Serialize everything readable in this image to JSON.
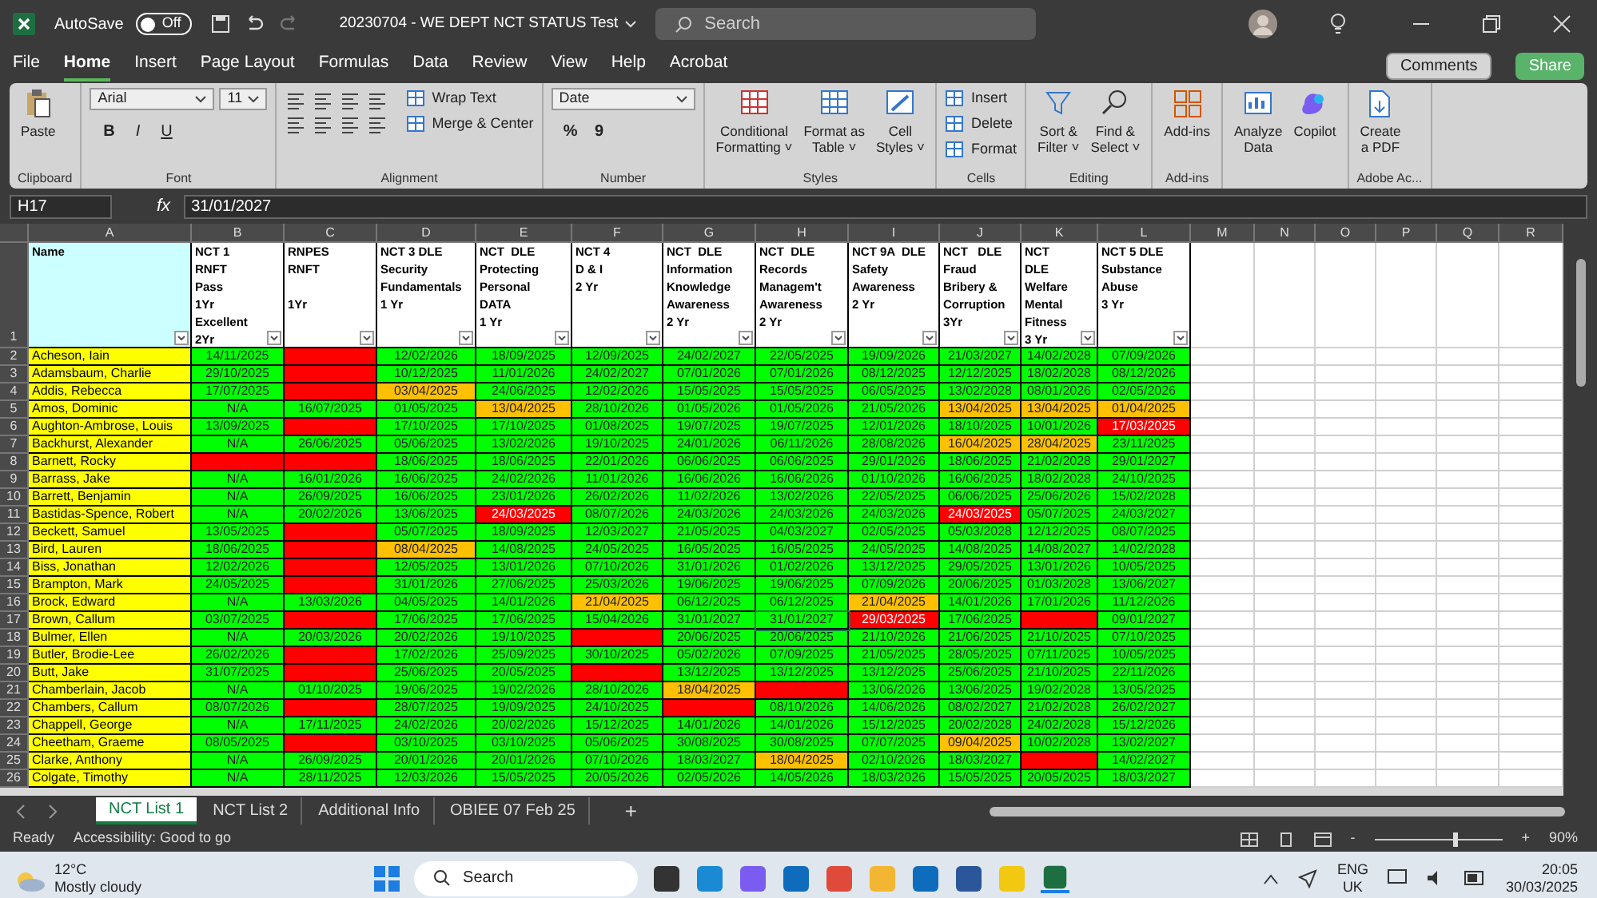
{
  "title_bar": {
    "autosave_label": "AutoSave",
    "autosave_state": "Off",
    "autosave_on": false,
    "file_name": "20230704 - WE DEPT NCT STATUS Test",
    "search_placeholder": "Search"
  },
  "menu": [
    {
      "label": "File",
      "selected": false
    },
    {
      "label": "Home",
      "selected": true
    },
    {
      "label": "Insert",
      "selected": false
    },
    {
      "label": "Page Layout",
      "selected": false
    },
    {
      "label": "Formulas",
      "selected": false
    },
    {
      "label": "Data",
      "selected": false
    },
    {
      "label": "Review",
      "selected": false
    },
    {
      "label": "View",
      "selected": false
    },
    {
      "label": "Help",
      "selected": false
    },
    {
      "label": "Acrobat",
      "selected": false
    }
  ],
  "comments_button": "Comments",
  "share_button": "Share",
  "ribbon": [
    {
      "label": "Clipboard",
      "buttons": [
        {
          "kind": "large",
          "label": "Paste"
        }
      ]
    },
    {
      "label": "Font",
      "buttons": [
        {
          "kind": "field",
          "label": "Arial"
        },
        {
          "kind": "field",
          "label": "11"
        },
        {
          "kind": "glyph",
          "label": "B"
        },
        {
          "kind": "glyph",
          "label": "I"
        },
        {
          "kind": "glyph",
          "label": "U"
        }
      ]
    },
    {
      "label": "Alignment",
      "buttons": [
        {
          "kind": "small",
          "label": "Wrap Text"
        },
        {
          "kind": "small",
          "label": "Merge & Center"
        }
      ]
    },
    {
      "label": "Number",
      "buttons": [
        {
          "kind": "field",
          "label": "Date"
        },
        {
          "kind": "glyph",
          "label": "%"
        },
        {
          "kind": "glyph",
          "label": "9"
        }
      ]
    },
    {
      "label": "Styles",
      "buttons": [
        {
          "kind": "large",
          "label": "Conditional\nFormatting ˅"
        },
        {
          "kind": "large",
          "label": "Format as\nTable ˅"
        },
        {
          "kind": "large",
          "label": "Cell\nStyles ˅"
        }
      ]
    },
    {
      "label": "Cells",
      "buttons": [
        {
          "kind": "small",
          "label": "Insert"
        },
        {
          "kind": "small",
          "label": "Delete"
        },
        {
          "kind": "small",
          "label": "Format"
        }
      ]
    },
    {
      "label": "Editing",
      "buttons": [
        {
          "kind": "large",
          "label": "Sort &\nFilter ˅"
        },
        {
          "kind": "large",
          "label": "Find &\nSelect ˅"
        }
      ]
    },
    {
      "label": "Add-ins",
      "buttons": [
        {
          "kind": "large",
          "label": "Add-ins"
        }
      ]
    },
    {
      "buttons": [
        {
          "kind": "large",
          "label": "Analyze\nData"
        },
        {
          "kind": "large",
          "label": "Copilot"
        }
      ]
    },
    {
      "label": "Adobe Ac...",
      "buttons": [
        {
          "kind": "large",
          "label": "Create\na PDF"
        }
      ]
    }
  ],
  "formula_bar": {
    "name_box": "H17",
    "fx": "fx",
    "formula": "31/01/2027"
  },
  "header_row_number": "1",
  "column_letters": [
    "A",
    "B",
    "C",
    "D",
    "E",
    "F",
    "G",
    "H",
    "I",
    "J",
    "K",
    "L",
    "M",
    "N",
    "O",
    "P",
    "Q",
    "R"
  ],
  "headers": [
    "Name",
    "NCT 1\nRNFT\nPass\n1Yr\nExcellent\n2Yr",
    "RNPES\nRNFT\n\n1Yr",
    "NCT 3 DLE\nSecurity\nFundamentals\n1 Yr",
    "NCT  DLE\nProtecting\nPersonal\nDATA\n1 Yr",
    "NCT 4\nD & I\n2 Yr",
    "NCT  DLE\nInformation\nKnowledge\nAwareness\n2 Yr",
    "NCT  DLE\nRecords\nManagem't\nAwareness\n2 Yr",
    "NCT 9A  DLE\nSafety\nAwareness\n2 Yr",
    "NCT   DLE\nFraud\nBribery &\nCorruption\n3Yr",
    "NCT\nDLE\nWelfare\nMental\nFitness\n3 Yr",
    "NCT 5 DLE\nSubstance\nAbuse\n3 Yr"
  ],
  "rows": [
    {
      "number": "2",
      "name": "Acheson, Iain",
      "cells": [
        {
          "text": "14/11/2025",
          "color": "#00ff00"
        },
        {
          "color": "#ff0000"
        },
        {
          "text": "12/02/2026",
          "color": "#00ff00"
        },
        {
          "text": "18/09/2025",
          "color": "#00ff00"
        },
        {
          "text": "12/09/2025",
          "color": "#00ff00"
        },
        {
          "text": "24/02/2027",
          "color": "#00ff00"
        },
        {
          "text": "22/05/2025",
          "color": "#00ff00"
        },
        {
          "text": "19/09/2026",
          "color": "#00ff00"
        },
        {
          "text": "21/03/2027",
          "color": "#00ff00"
        },
        {
          "text": "14/02/2028",
          "color": "#00ff00"
        },
        {
          "text": "07/09/2026",
          "color": "#00ff00"
        }
      ]
    },
    {
      "number": "3",
      "name": "Adamsbaum, Charlie",
      "cells": [
        {
          "text": "29/10/2025",
          "color": "#00ff00"
        },
        {
          "color": "#ff0000"
        },
        {
          "text": "10/12/2025",
          "color": "#00ff00"
        },
        {
          "text": "11/01/2026",
          "color": "#00ff00"
        },
        {
          "text": "24/02/2027",
          "color": "#00ff00"
        },
        {
          "text": "07/01/2026",
          "color": "#00ff00"
        },
        {
          "text": "07/01/2026",
          "color": "#00ff00"
        },
        {
          "text": "08/12/2025",
          "color": "#00ff00"
        },
        {
          "text": "12/12/2025",
          "color": "#00ff00"
        },
        {
          "text": "18/02/2028",
          "color": "#00ff00"
        },
        {
          "text": "08/12/2026",
          "color": "#00ff00"
        }
      ]
    },
    {
      "number": "4",
      "name": "Addis, Rebecca",
      "cells": [
        {
          "text": "17/07/2025",
          "color": "#00ff00"
        },
        {
          "color": "#ff0000"
        },
        {
          "text": "03/04/2025",
          "color": "#ffc000"
        },
        {
          "text": "24/06/2025",
          "color": "#00ff00"
        },
        {
          "text": "12/02/2026",
          "color": "#00ff00"
        },
        {
          "text": "15/05/2025",
          "color": "#00ff00"
        },
        {
          "text": "15/05/2025",
          "color": "#00ff00"
        },
        {
          "text": "06/05/2025",
          "color": "#00ff00"
        },
        {
          "text": "13/02/2028",
          "color": "#00ff00"
        },
        {
          "text": "08/01/2026",
          "color": "#00ff00"
        },
        {
          "text": "02/05/2026",
          "color": "#00ff00"
        }
      ]
    },
    {
      "number": "5",
      "name": "Amos, Dominic",
      "cells": [
        {
          "text": "N/A",
          "color": "#00ff00"
        },
        {
          "text": "16/07/2025",
          "color": "#00ff00"
        },
        {
          "text": "01/05/2025",
          "color": "#00ff00"
        },
        {
          "text": "13/04/2025",
          "color": "#ffc000"
        },
        {
          "text": "28/10/2026",
          "color": "#00ff00"
        },
        {
          "text": "01/05/2026",
          "color": "#00ff00"
        },
        {
          "text": "01/05/2026",
          "color": "#00ff00"
        },
        {
          "text": "21/05/2026",
          "color": "#00ff00"
        },
        {
          "text": "13/04/2025",
          "color": "#ffc000"
        },
        {
          "text": "13/04/2025",
          "color": "#ffc000"
        },
        {
          "text": "01/04/2025",
          "color": "#ffc000"
        }
      ]
    },
    {
      "number": "6",
      "name": "Aughton-Ambrose, Louis",
      "cells": [
        {
          "text": "13/09/2025",
          "color": "#00ff00"
        },
        {
          "color": "#ff0000"
        },
        {
          "text": "17/10/2025",
          "color": "#00ff00"
        },
        {
          "text": "17/10/2025",
          "color": "#00ff00"
        },
        {
          "text": "01/08/2025",
          "color": "#00ff00"
        },
        {
          "text": "19/07/2025",
          "color": "#00ff00"
        },
        {
          "text": "19/07/2025",
          "color": "#00ff00"
        },
        {
          "text": "12/01/2026",
          "color": "#00ff00"
        },
        {
          "text": "18/10/2025",
          "color": "#00ff00"
        },
        {
          "text": "10/01/2026",
          "color": "#00ff00"
        },
        {
          "text": "17/03/2025",
          "color": "#ff0000"
        }
      ]
    },
    {
      "number": "7",
      "name": "Backhurst, Alexander",
      "cells": [
        {
          "text": "N/A",
          "color": "#00ff00"
        },
        {
          "text": "26/06/2025",
          "color": "#00ff00"
        },
        {
          "text": "05/06/2025",
          "color": "#00ff00"
        },
        {
          "text": "13/02/2026",
          "color": "#00ff00"
        },
        {
          "text": "19/10/2025",
          "color": "#00ff00"
        },
        {
          "text": "24/01/2026",
          "color": "#00ff00"
        },
        {
          "text": "06/11/2026",
          "color": "#00ff00"
        },
        {
          "text": "28/08/2026",
          "color": "#00ff00"
        },
        {
          "text": "16/04/2025",
          "color": "#ffc000"
        },
        {
          "text": "28/04/2025",
          "color": "#ffc000"
        },
        {
          "text": "23/11/2025",
          "color": "#00ff00"
        }
      ]
    },
    {
      "number": "8",
      "name": "Barnett, Rocky",
      "cells": [
        {
          "color": "#ff0000"
        },
        {
          "color": "#ff0000"
        },
        {
          "text": "18/06/2025",
          "color": "#00ff00"
        },
        {
          "text": "18/06/2025",
          "color": "#00ff00"
        },
        {
          "text": "22/01/2026",
          "color": "#00ff00"
        },
        {
          "text": "06/06/2025",
          "color": "#00ff00"
        },
        {
          "text": "06/06/2025",
          "color": "#00ff00"
        },
        {
          "text": "29/01/2026",
          "color": "#00ff00"
        },
        {
          "text": "18/06/2025",
          "color": "#00ff00"
        },
        {
          "text": "21/02/2028",
          "color": "#00ff00"
        },
        {
          "text": "29/01/2027",
          "color": "#00ff00"
        }
      ]
    },
    {
      "number": "9",
      "name": "Barrass, Jake",
      "cells": [
        {
          "text": "N/A",
          "color": "#00ff00"
        },
        {
          "text": "16/01/2026",
          "color": "#00ff00"
        },
        {
          "text": "16/06/2025",
          "color": "#00ff00"
        },
        {
          "text": "24/02/2026",
          "color": "#00ff00"
        },
        {
          "text": "11/01/2026",
          "color": "#00ff00"
        },
        {
          "text": "16/06/2026",
          "color": "#00ff00"
        },
        {
          "text": "16/06/2026",
          "color": "#00ff00"
        },
        {
          "text": "01/10/2026",
          "color": "#00ff00"
        },
        {
          "text": "16/06/2025",
          "color": "#00ff00"
        },
        {
          "text": "18/02/2028",
          "color": "#00ff00"
        },
        {
          "text": "24/10/2025",
          "color": "#00ff00"
        }
      ]
    },
    {
      "number": "10",
      "name": "Barrett, Benjamin",
      "cells": [
        {
          "text": "N/A",
          "color": "#00ff00"
        },
        {
          "text": "26/09/2025",
          "color": "#00ff00"
        },
        {
          "text": "16/06/2025",
          "color": "#00ff00"
        },
        {
          "text": "23/01/2026",
          "color": "#00ff00"
        },
        {
          "text": "26/02/2026",
          "color": "#00ff00"
        },
        {
          "text": "11/02/2026",
          "color": "#00ff00"
        },
        {
          "text": "13/02/2026",
          "color": "#00ff00"
        },
        {
          "text": "22/05/2025",
          "color": "#00ff00"
        },
        {
          "text": "06/06/2025",
          "color": "#00ff00"
        },
        {
          "text": "25/06/2026",
          "color": "#00ff00"
        },
        {
          "text": "15/02/2028",
          "color": "#00ff00"
        }
      ]
    },
    {
      "number": "11",
      "name": "Bastidas-Spence, Robert",
      "cells": [
        {
          "text": "N/A",
          "color": "#00ff00"
        },
        {
          "text": "20/02/2026",
          "color": "#00ff00"
        },
        {
          "text": "13/06/2025",
          "color": "#00ff00"
        },
        {
          "text": "24/03/2025",
          "color": "#ff0000"
        },
        {
          "text": "08/07/2026",
          "color": "#00ff00"
        },
        {
          "text": "24/03/2026",
          "color": "#00ff00"
        },
        {
          "text": "24/03/2026",
          "color": "#00ff00"
        },
        {
          "text": "24/03/2026",
          "color": "#00ff00"
        },
        {
          "text": "24/03/2025",
          "color": "#ff0000"
        },
        {
          "text": "05/07/2025",
          "color": "#00ff00"
        },
        {
          "text": "24/03/2027",
          "color": "#00ff00"
        }
      ]
    },
    {
      "number": "12",
      "name": "Beckett, Samuel",
      "cells": [
        {
          "text": "13/05/2025",
          "color": "#00ff00"
        },
        {
          "color": "#ff0000"
        },
        {
          "text": "05/07/2025",
          "color": "#00ff00"
        },
        {
          "text": "18/09/2025",
          "color": "#00ff00"
        },
        {
          "text": "12/03/2027",
          "color": "#00ff00"
        },
        {
          "text": "21/05/2025",
          "color": "#00ff00"
        },
        {
          "text": "04/03/2027",
          "color": "#00ff00"
        },
        {
          "text": "02/05/2025",
          "color": "#00ff00"
        },
        {
          "text": "05/03/2028",
          "color": "#00ff00"
        },
        {
          "text": "12/12/2025",
          "color": "#00ff00"
        },
        {
          "text": "08/07/2025",
          "color": "#00ff00"
        }
      ]
    },
    {
      "number": "13",
      "name": "Bird, Lauren",
      "cells": [
        {
          "text": "18/06/2025",
          "color": "#00ff00"
        },
        {
          "color": "#ff0000"
        },
        {
          "text": "08/04/2025",
          "color": "#ffc000"
        },
        {
          "text": "14/08/2025",
          "color": "#00ff00"
        },
        {
          "text": "24/05/2025",
          "color": "#00ff00"
        },
        {
          "text": "16/05/2025",
          "color": "#00ff00"
        },
        {
          "text": "16/05/2025",
          "color": "#00ff00"
        },
        {
          "text": "24/05/2025",
          "color": "#00ff00"
        },
        {
          "text": "14/08/2025",
          "color": "#00ff00"
        },
        {
          "text": "14/08/2027",
          "color": "#00ff00"
        },
        {
          "text": "14/02/2028",
          "color": "#00ff00"
        }
      ]
    },
    {
      "number": "14",
      "name": "Biss, Jonathan",
      "cells": [
        {
          "text": "12/02/2026",
          "color": "#00ff00"
        },
        {
          "color": "#ff0000"
        },
        {
          "text": "12/05/2025",
          "color": "#00ff00"
        },
        {
          "text": "13/01/2026",
          "color": "#00ff00"
        },
        {
          "text": "07/10/2026",
          "color": "#00ff00"
        },
        {
          "text": "31/01/2026",
          "color": "#00ff00"
        },
        {
          "text": "01/02/2026",
          "color": "#00ff00"
        },
        {
          "text": "13/12/2025",
          "color": "#00ff00"
        },
        {
          "text": "29/05/2025",
          "color": "#00ff00"
        },
        {
          "text": "13/01/2026",
          "color": "#00ff00"
        },
        {
          "text": "10/05/2025",
          "color": "#00ff00"
        }
      ]
    },
    {
      "number": "15",
      "name": "Brampton, Mark",
      "cells": [
        {
          "text": "24/05/2025",
          "color": "#00ff00"
        },
        {
          "color": "#ff0000"
        },
        {
          "text": "31/01/2026",
          "color": "#00ff00"
        },
        {
          "text": "27/06/2025",
          "color": "#00ff00"
        },
        {
          "text": "25/03/2026",
          "color": "#00ff00"
        },
        {
          "text": "19/06/2025",
          "color": "#00ff00"
        },
        {
          "text": "19/06/2025",
          "color": "#00ff00"
        },
        {
          "text": "07/09/2026",
          "color": "#00ff00"
        },
        {
          "text": "20/06/2025",
          "color": "#00ff00"
        },
        {
          "text": "01/03/2028",
          "color": "#00ff00"
        },
        {
          "text": "13/06/2027",
          "color": "#00ff00"
        }
      ]
    },
    {
      "number": "16",
      "name": "Brock, Edward",
      "cells": [
        {
          "text": "N/A",
          "color": "#00ff00"
        },
        {
          "text": "13/03/2026",
          "color": "#00ff00"
        },
        {
          "text": "04/05/2025",
          "color": "#00ff00"
        },
        {
          "text": "14/01/2026",
          "color": "#00ff00"
        },
        {
          "text": "21/04/2025",
          "color": "#ffc000"
        },
        {
          "text": "06/12/2025",
          "color": "#00ff00"
        },
        {
          "text": "06/12/2025",
          "color": "#00ff00"
        },
        {
          "text": "21/04/2025",
          "color": "#ffc000"
        },
        {
          "text": "14/01/2026",
          "color": "#00ff00"
        },
        {
          "text": "17/01/2026",
          "color": "#00ff00"
        },
        {
          "text": "11/12/2026",
          "color": "#00ff00"
        }
      ]
    },
    {
      "number": "17",
      "name": "Brown, Callum",
      "cells": [
        {
          "text": "03/07/2025",
          "color": "#00ff00"
        },
        {
          "color": "#ff0000"
        },
        {
          "text": "17/06/2025",
          "color": "#00ff00"
        },
        {
          "text": "17/06/2025",
          "color": "#00ff00"
        },
        {
          "text": "15/04/2026",
          "color": "#00ff00"
        },
        {
          "text": "31/01/2027",
          "color": "#00ff00"
        },
        {
          "text": "31/01/2027",
          "color": "#00ff00",
          "selected": true
        },
        {
          "text": "29/03/2025",
          "color": "#ff0000"
        },
        {
          "text": "17/06/2025",
          "color": "#00ff00"
        },
        {
          "color": "#ff0000"
        },
        {
          "text": "09/01/2027",
          "color": "#00ff00"
        }
      ]
    },
    {
      "number": "18",
      "name": "Bulmer, Ellen",
      "cells": [
        {
          "text": "N/A",
          "color": "#00ff00"
        },
        {
          "text": "20/03/2026",
          "color": "#00ff00"
        },
        {
          "text": "20/02/2026",
          "color": "#00ff00"
        },
        {
          "text": "19/10/2025",
          "color": "#00ff00"
        },
        {
          "color": "#ff0000"
        },
        {
          "text": "20/06/2025",
          "color": "#00ff00"
        },
        {
          "text": "20/06/2025",
          "color": "#00ff00"
        },
        {
          "text": "21/10/2026",
          "color": "#00ff00"
        },
        {
          "text": "21/06/2025",
          "color": "#00ff00"
        },
        {
          "text": "21/10/2025",
          "color": "#00ff00"
        },
        {
          "text": "07/10/2025",
          "color": "#00ff00"
        }
      ]
    },
    {
      "number": "19",
      "name": "Butler, Brodie-Lee",
      "cells": [
        {
          "text": "26/02/2026",
          "color": "#00ff00"
        },
        {
          "color": "#ff0000"
        },
        {
          "text": "17/02/2026",
          "color": "#00ff00"
        },
        {
          "text": "25/09/2025",
          "color": "#00ff00"
        },
        {
          "text": "30/10/2025",
          "color": "#00ff00"
        },
        {
          "text": "05/02/2026",
          "color": "#00ff00"
        },
        {
          "text": "07/09/2025",
          "color": "#00ff00"
        },
        {
          "text": "21/05/2025",
          "color": "#00ff00"
        },
        {
          "text": "28/05/2025",
          "color": "#00ff00"
        },
        {
          "text": "07/11/2025",
          "color": "#00ff00"
        },
        {
          "text": "10/05/2025",
          "color": "#00ff00"
        }
      ]
    },
    {
      "number": "20",
      "name": "Butt, Jake",
      "cells": [
        {
          "text": "31/07/2025",
          "color": "#00ff00"
        },
        {
          "color": "#ff0000"
        },
        {
          "text": "25/06/2025",
          "color": "#00ff00"
        },
        {
          "text": "20/05/2025",
          "color": "#00ff00"
        },
        {
          "color": "#ff0000"
        },
        {
          "text": "13/12/2025",
          "color": "#00ff00"
        },
        {
          "text": "13/12/2025",
          "color": "#00ff00"
        },
        {
          "text": "13/12/2025",
          "color": "#00ff00"
        },
        {
          "text": "25/06/2025",
          "color": "#00ff00"
        },
        {
          "text": "21/10/2025",
          "color": "#00ff00"
        },
        {
          "text": "22/11/2026",
          "color": "#00ff00"
        }
      ]
    },
    {
      "number": "21",
      "name": "Chamberlain, Jacob",
      "cells": [
        {
          "text": "N/A",
          "color": "#00ff00"
        },
        {
          "text": "01/10/2025",
          "color": "#00ff00"
        },
        {
          "text": "19/06/2025",
          "color": "#00ff00"
        },
        {
          "text": "19/02/2026",
          "color": "#00ff00"
        },
        {
          "text": "28/10/2026",
          "color": "#00ff00"
        },
        {
          "text": "18/04/2025",
          "color": "#ffc000"
        },
        {
          "color": "#ff0000"
        },
        {
          "text": "13/06/2026",
          "color": "#00ff00"
        },
        {
          "text": "13/06/2025",
          "color": "#00ff00"
        },
        {
          "text": "19/02/2028",
          "color": "#00ff00"
        },
        {
          "text": "13/05/2025",
          "color": "#00ff00"
        }
      ]
    },
    {
      "number": "22",
      "name": "Chambers, Callum",
      "cells": [
        {
          "text": "08/07/2026",
          "color": "#00ff00"
        },
        {
          "color": "#ff0000"
        },
        {
          "text": "28/07/2025",
          "color": "#00ff00"
        },
        {
          "text": "19/09/2025",
          "color": "#00ff00"
        },
        {
          "text": "24/10/2025",
          "color": "#00ff00"
        },
        {
          "color": "#ff0000"
        },
        {
          "text": "08/10/2026",
          "color": "#00ff00"
        },
        {
          "text": "14/06/2026",
          "color": "#00ff00"
        },
        {
          "text": "08/02/2027",
          "color": "#00ff00"
        },
        {
          "text": "21/02/2028",
          "color": "#00ff00"
        },
        {
          "text": "26/02/2027",
          "color": "#00ff00"
        }
      ]
    },
    {
      "number": "23",
      "name": "Chappell,  George",
      "cells": [
        {
          "text": "N/A",
          "color": "#00ff00"
        },
        {
          "text": "17/11/2025",
          "color": "#00ff00"
        },
        {
          "text": "24/02/2026",
          "color": "#00ff00"
        },
        {
          "text": "20/02/2026",
          "color": "#00ff00"
        },
        {
          "text": "15/12/2025",
          "color": "#00ff00"
        },
        {
          "text": "14/01/2026",
          "color": "#00ff00"
        },
        {
          "text": "14/01/2026",
          "color": "#00ff00"
        },
        {
          "text": "15/12/2025",
          "color": "#00ff00"
        },
        {
          "text": "20/02/2028",
          "color": "#00ff00"
        },
        {
          "text": "24/02/2028",
          "color": "#00ff00"
        },
        {
          "text": "15/12/2026",
          "color": "#00ff00"
        }
      ]
    },
    {
      "number": "24",
      "name": "Cheetham, Graeme",
      "cells": [
        {
          "text": "08/05/2025",
          "color": "#00ff00"
        },
        {
          "color": "#ff0000"
        },
        {
          "text": "03/10/2025",
          "color": "#00ff00"
        },
        {
          "text": "03/10/2025",
          "color": "#00ff00"
        },
        {
          "text": "05/06/2025",
          "color": "#00ff00"
        },
        {
          "text": "30/08/2025",
          "color": "#00ff00"
        },
        {
          "text": "30/08/2025",
          "color": "#00ff00"
        },
        {
          "text": "07/07/2025",
          "color": "#00ff00"
        },
        {
          "text": "09/04/2025",
          "color": "#ffc000"
        },
        {
          "text": "10/02/2028",
          "color": "#00ff00"
        },
        {
          "text": "13/02/2027",
          "color": "#00ff00"
        }
      ]
    },
    {
      "number": "25",
      "name": "Clarke, Anthony",
      "cells": [
        {
          "text": "N/A",
          "color": "#00ff00"
        },
        {
          "text": "26/09/2025",
          "color": "#00ff00"
        },
        {
          "text": "20/01/2026",
          "color": "#00ff00"
        },
        {
          "text": "20/01/2026",
          "color": "#00ff00"
        },
        {
          "text": "07/10/2026",
          "color": "#00ff00"
        },
        {
          "text": "18/03/2027",
          "color": "#00ff00"
        },
        {
          "text": "18/04/2025",
          "color": "#ffc000"
        },
        {
          "text": "02/10/2026",
          "color": "#00ff00"
        },
        {
          "text": "18/03/2027",
          "color": "#00ff00"
        },
        {
          "color": "#ff0000"
        },
        {
          "text": "14/02/2027",
          "color": "#00ff00"
        }
      ]
    },
    {
      "number": "26",
      "name": "Colgate, Timothy",
      "cells": [
        {
          "text": "N/A",
          "color": "#00ff00"
        },
        {
          "text": "28/11/2025",
          "color": "#00ff00"
        },
        {
          "text": "12/03/2026",
          "color": "#00ff00"
        },
        {
          "text": "15/05/2025",
          "color": "#00ff00"
        },
        {
          "text": "20/05/2026",
          "color": "#00ff00"
        },
        {
          "text": "02/05/2026",
          "color": "#00ff00"
        },
        {
          "text": "14/05/2026",
          "color": "#00ff00"
        },
        {
          "text": "18/03/2026",
          "color": "#00ff00"
        },
        {
          "text": "15/05/2025",
          "color": "#00ff00"
        },
        {
          "text": "20/05/2025",
          "color": "#00ff00"
        },
        {
          "text": "18/03/2027",
          "color": "#00ff00"
        }
      ]
    }
  ],
  "sheet_tabs": [
    {
      "label": "NCT List 1",
      "selected": true
    },
    {
      "label": "NCT List 2",
      "selected": false
    },
    {
      "label": "Additional Info",
      "selected": false
    },
    {
      "label": "OBIEE 07 Feb 25",
      "selected": false
    }
  ],
  "add_sheet": "+",
  "status_bar": {
    "mode": "Ready",
    "accessibility": "Accessibility: Good to go",
    "zoom": "90%",
    "zoom_minus": "-",
    "zoom_plus": "+",
    "level": 0.62
  },
  "taskbar": {
    "temperature": "12°C",
    "weather": "Mostly cloudy",
    "search": "Search",
    "language": "ENG",
    "region": "UK",
    "time": "20:05",
    "date": "30/03/2025"
  }
}
